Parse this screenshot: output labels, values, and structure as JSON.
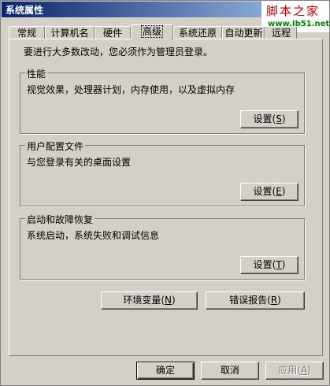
{
  "window": {
    "title": "系统属性"
  },
  "watermark": {
    "brand": "脚本之家",
    "url": "www.Jb51.net"
  },
  "tabs": [
    {
      "label": "常规"
    },
    {
      "label": "计算机名"
    },
    {
      "label": "硬件"
    },
    {
      "label": "高级"
    },
    {
      "label": "系统还原"
    },
    {
      "label": "自动更新"
    },
    {
      "label": "远程"
    }
  ],
  "active_tab": "高级",
  "intro": "要进行大多数改动，您必须作为管理员登录。",
  "groups": {
    "performance": {
      "title": "性能",
      "description": "视觉效果，处理器计划，内存使用，以及虚拟内存",
      "button": "设置",
      "accel": "S"
    },
    "profiles": {
      "title": "用户配置文件",
      "description": "与您登录有关的桌面设置",
      "button": "设置",
      "accel": "E"
    },
    "startup": {
      "title": "启动和故障恢复",
      "description": "系统启动，系统失败和调试信息",
      "button": "设置",
      "accel": "T"
    }
  },
  "actions": {
    "env": {
      "label": "环境变量",
      "accel": "N"
    },
    "error": {
      "label": "错误报告",
      "accel": "R"
    }
  },
  "footer": {
    "ok": "确定",
    "cancel": "取消",
    "apply": {
      "label": "应用",
      "accel": "A"
    }
  }
}
